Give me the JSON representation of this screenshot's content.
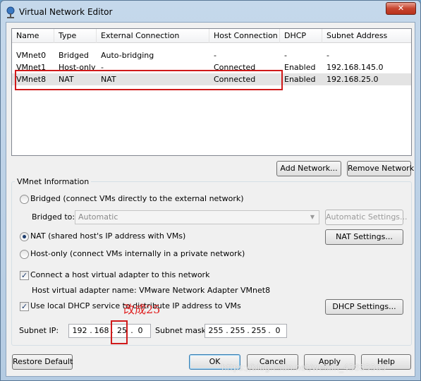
{
  "window": {
    "title": "Virtual Network Editor",
    "close_label": "✕"
  },
  "network_list": {
    "columns": [
      "Name",
      "Type",
      "External Connection",
      "Host Connection",
      "DHCP",
      "Subnet Address"
    ],
    "rows": [
      {
        "name": "VMnet0",
        "type": "Bridged",
        "external": "Auto-bridging",
        "host": "-",
        "dhcp": "-",
        "subnet": "-"
      },
      {
        "name": "VMnet1",
        "type": "Host-only",
        "external": "-",
        "host": "Connected",
        "dhcp": "Enabled",
        "subnet": "192.168.145.0"
      },
      {
        "name": "VMnet8",
        "type": "NAT",
        "external": "NAT",
        "host": "Connected",
        "dhcp": "Enabled",
        "subnet": "192.168.25.0"
      }
    ],
    "selected_row": 2
  },
  "list_buttons": {
    "add_network": "Add Network...",
    "remove_network": "Remove Network"
  },
  "vmnet_info": {
    "legend": "VMnet Information",
    "bridged_label": "Bridged (connect VMs directly to the external network)",
    "bridged_to_label": "Bridged to:",
    "bridged_to_value": "Automatic",
    "auto_settings_label": "Automatic Settings...",
    "nat_label": "NAT (shared host's IP address with VMs)",
    "nat_settings_label": "NAT Settings...",
    "hostonly_label": "Host-only (connect VMs internally in a private network)",
    "connect_adapter_label": "Connect a host virtual adapter to this network",
    "adapter_name_label": "Host virtual adapter name: VMware Network Adapter VMnet8",
    "dhcp_label": "Use local DHCP service to distribute IP address to VMs",
    "dhcp_settings_label": "DHCP Settings...",
    "subnet_ip_label": "Subnet IP:",
    "subnet_ip": [
      "192",
      "168",
      "25",
      "0"
    ],
    "subnet_mask_label": "Subnet mask:",
    "subnet_mask": [
      "255",
      "255",
      "255",
      "0"
    ],
    "selected_mode": "nat",
    "connect_adapter_checked": true,
    "dhcp_checked": true
  },
  "annotation": {
    "text": "改成25",
    "color": "#d01a1a"
  },
  "footer": {
    "restore_default": "Restore Default",
    "ok": "OK",
    "cancel": "Cancel",
    "apply": "Apply",
    "help": "Help"
  },
  "watermark": "https://blog.csdn.net/weixin_43883369"
}
